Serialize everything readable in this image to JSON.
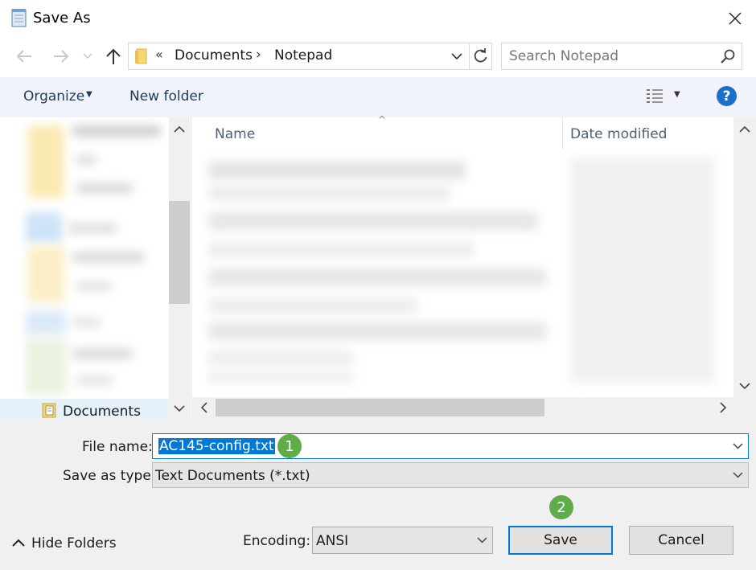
{
  "window": {
    "title": "Save As",
    "icon": "notepad-icon"
  },
  "address": {
    "overflow": "«",
    "crumbs": [
      "Documents",
      "Notepad"
    ],
    "separator": "›"
  },
  "search": {
    "placeholder": "Search Notepad"
  },
  "toolbar": {
    "organize_label": "Organize",
    "new_folder_label": "New folder",
    "help_label": "?"
  },
  "nav": {
    "selected_item": "Documents"
  },
  "filelist": {
    "columns": [
      "Name",
      "Date modified"
    ]
  },
  "form": {
    "file_name_label": "File name:",
    "file_name_value": "AC145-config.txt",
    "save_type_label": "Save as type:",
    "save_type_value": "Text Documents (*.txt)",
    "encoding_label": "Encoding:",
    "encoding_value": "ANSI"
  },
  "buttons": {
    "hide_folders": "Hide Folders",
    "save": "Save",
    "cancel": "Cancel"
  },
  "callouts": {
    "step1": "1",
    "step2": "2"
  },
  "colors": {
    "accent": "#0078d7",
    "callout": "#5fad48",
    "help": "#1a6fcf"
  }
}
